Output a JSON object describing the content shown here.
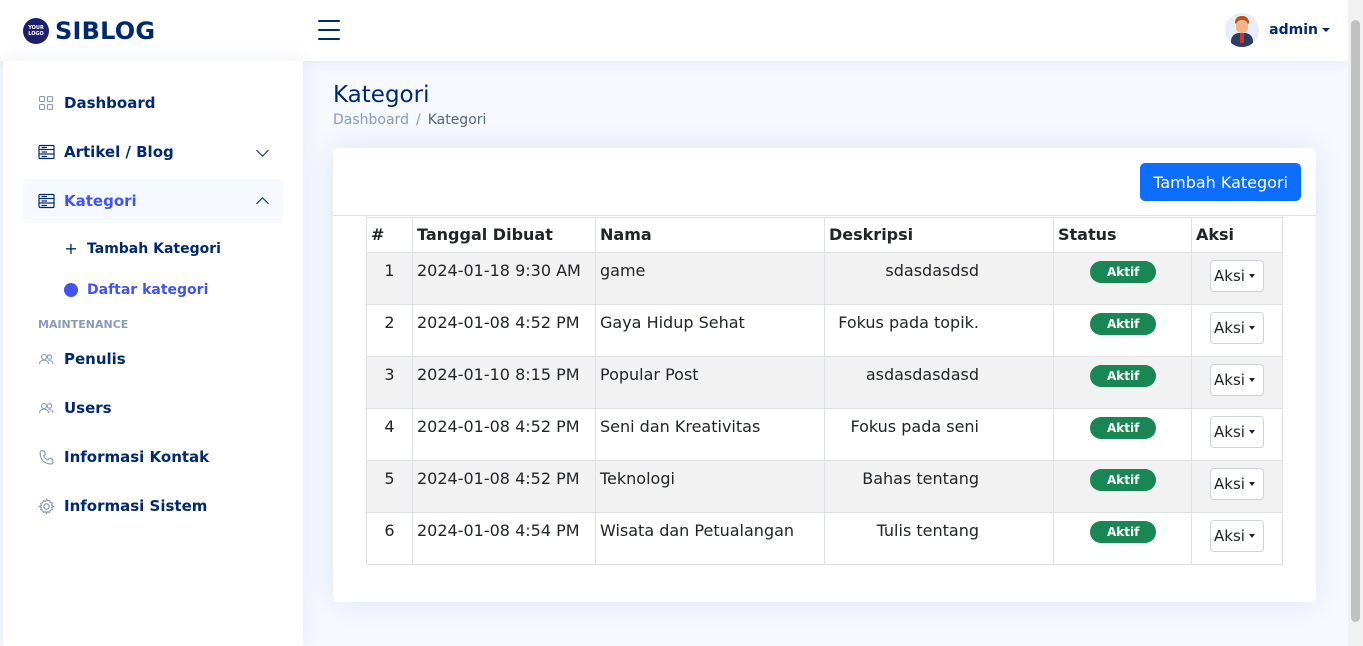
{
  "header": {
    "logo_badge": "YOUR LOGO",
    "app_name": "SIBLOG",
    "user": "admin"
  },
  "sidebar": {
    "items": [
      {
        "label": "Dashboard",
        "icon": "grid-icon"
      },
      {
        "label": "Artikel / Blog",
        "icon": "layout-text-icon"
      },
      {
        "label": "Kategori",
        "icon": "layout-text-icon"
      }
    ],
    "subitems": [
      {
        "label": "Tambah Kategori",
        "icon": "plus-icon"
      },
      {
        "label": "Daftar kategori",
        "icon": "circle-icon"
      }
    ],
    "heading": "MAINTENANCE",
    "maintenance": [
      {
        "label": "Penulis",
        "icon": "people-icon"
      },
      {
        "label": "Users",
        "icon": "people-icon"
      },
      {
        "label": "Informasi Kontak",
        "icon": "telephone-icon"
      },
      {
        "label": "Informasi Sistem",
        "icon": "gear-icon"
      }
    ]
  },
  "page": {
    "title": "Kategori",
    "breadcrumb": [
      "Dashboard",
      "Kategori"
    ],
    "add_button": "Tambah Kategori"
  },
  "table": {
    "headers": [
      "#",
      "Tanggal Dibuat",
      "Nama",
      "Deskripsi",
      "Status",
      "Aksi"
    ],
    "rows": [
      {
        "no": "1",
        "date": "2024-01-18 9:30 AM",
        "name": "game",
        "desc": "sdasdasdsd",
        "status": "Aktif",
        "action": "Aksi"
      },
      {
        "no": "2",
        "date": "2024-01-08 4:52 PM",
        "name": "Gaya Hidup Sehat",
        "desc": "Fokus pada topik.",
        "status": "Aktif",
        "action": "Aksi"
      },
      {
        "no": "3",
        "date": "2024-01-10 8:15 PM",
        "name": "Popular Post",
        "desc": "asdasdasdasd",
        "status": "Aktif",
        "action": "Aksi"
      },
      {
        "no": "4",
        "date": "2024-01-08 4:52 PM",
        "name": "Seni dan Kreativitas",
        "desc": "Fokus pada seni",
        "status": "Aktif",
        "action": "Aksi"
      },
      {
        "no": "5",
        "date": "2024-01-08 4:52 PM",
        "name": "Teknologi",
        "desc": "Bahas tentang",
        "status": "Aktif",
        "action": "Aksi"
      },
      {
        "no": "6",
        "date": "2024-01-08 4:54 PM",
        "name": "Wisata dan Petualangan",
        "desc": "Tulis tentang",
        "status": "Aktif",
        "action": "Aksi"
      }
    ]
  },
  "colors": {
    "primary": "#4154f1",
    "navy": "#012970",
    "button": "#0d6efd",
    "badge": "#198754"
  }
}
